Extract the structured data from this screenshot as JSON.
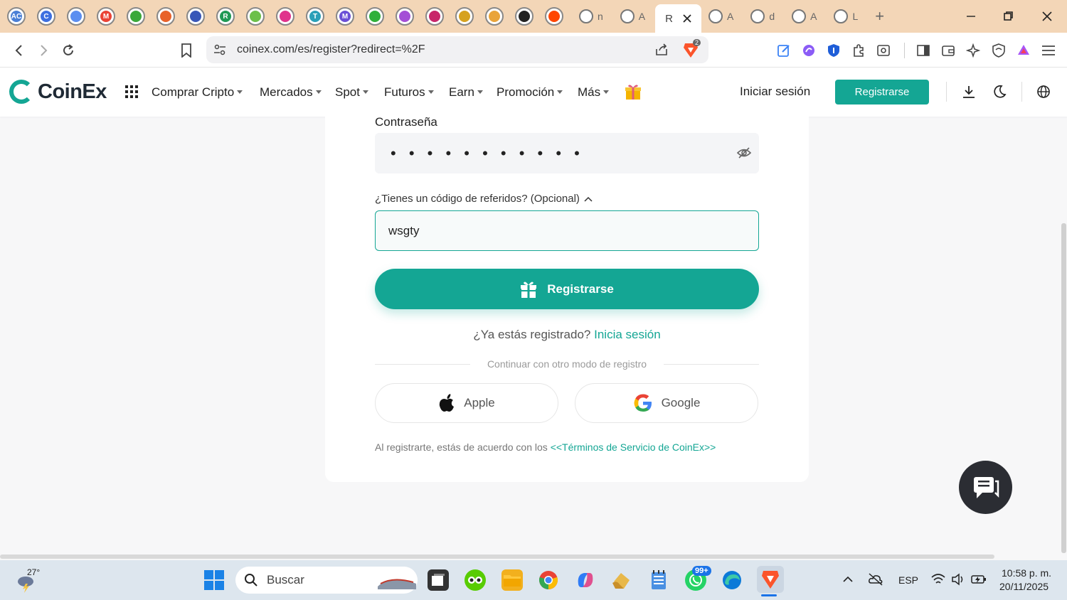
{
  "browser": {
    "pinned_tabs": [
      {
        "icon": "aclick-icon",
        "color": "#4a7fd6",
        "letter": "AC"
      },
      {
        "icon": "c-coin-icon",
        "color": "#3d6fe0",
        "letter": "C"
      },
      {
        "icon": "search-coin-icon",
        "color": "#5b8ef0",
        "letter": ""
      },
      {
        "icon": "gmail-icon",
        "color": "#ea4335",
        "letter": "M"
      },
      {
        "icon": "leaf-icon",
        "color": "#3aa83a",
        "letter": ""
      },
      {
        "icon": "rainbow-icon",
        "color": "#e8622a",
        "letter": ""
      },
      {
        "icon": "cloud-icon",
        "color": "#3957b8",
        "letter": ""
      },
      {
        "icon": "r-coin-icon",
        "color": "#1f9a55",
        "letter": "R"
      },
      {
        "icon": "bolt-icon",
        "color": "#6cc04a",
        "letter": ""
      },
      {
        "icon": "chat-bubble-icon",
        "color": "#e0338c",
        "letter": ""
      },
      {
        "icon": "t-coin-icon",
        "color": "#2aa0b8",
        "letter": "T"
      },
      {
        "icon": "m-coin-icon",
        "color": "#6b4fd6",
        "letter": "M"
      },
      {
        "icon": "green-face-icon",
        "color": "#2fb03a",
        "letter": ""
      },
      {
        "icon": "flower-icon",
        "color": "#a44fd6",
        "letter": ""
      },
      {
        "icon": "rocket-icon",
        "color": "#c8266a",
        "letter": ""
      },
      {
        "icon": "emoji-icon",
        "color": "#d6a21f",
        "letter": ""
      },
      {
        "icon": "coin-icon",
        "color": "#e9a43a",
        "letter": ""
      },
      {
        "icon": "github-icon",
        "color": "#222222",
        "letter": ""
      },
      {
        "icon": "reddit-icon",
        "color": "#ff4500",
        "letter": ""
      }
    ],
    "tabs": [
      {
        "icon": "github-icon",
        "label": "n"
      },
      {
        "icon": "leaf-icon",
        "label": "A"
      },
      {
        "active_label": "R"
      },
      {
        "icon": "leaf-icon",
        "label": "A"
      },
      {
        "icon": "google-icon",
        "label": "d"
      },
      {
        "icon": "amazon-icon",
        "label": "A"
      },
      {
        "icon": "globe-color-icon",
        "label": "L"
      }
    ],
    "new_tab": "+",
    "url": "coinex.com/es/register?redirect=%2F",
    "brave_badge": "2"
  },
  "header": {
    "logo_text": "CoinEx",
    "menu": [
      {
        "label": "Comprar Cripto"
      },
      {
        "label": "Mercados"
      },
      {
        "label": "Spot"
      },
      {
        "label": "Futuros"
      },
      {
        "label": "Earn"
      },
      {
        "label": "Promoción"
      },
      {
        "label": "Más"
      }
    ],
    "login": "Iniciar sesión",
    "register": "Registrarse",
    "accent": "#14a694"
  },
  "form": {
    "password_label": "Contraseña",
    "password_mask": "• • • • • • • • • • •",
    "referral_toggle": "¿Tienes un código de referidos? (Opcional)",
    "referral_value": "wsgty",
    "submit": "Registrarse",
    "already_text": "¿Ya estás registrado?",
    "already_link": "Inicia sesión",
    "divider_text": "Continuar con otro modo de registro",
    "apple": "Apple",
    "google": "Google",
    "terms_text": "Al registrarte, estás de acuerdo con los",
    "terms_link": "<<Términos de Servicio de CoinEx>>"
  },
  "taskbar": {
    "weather": "27°",
    "search_placeholder": "Buscar",
    "whatsapp_badge": "99+",
    "lang": "ESP",
    "time": "10:58 p. m.",
    "date": "20/11/2025"
  }
}
